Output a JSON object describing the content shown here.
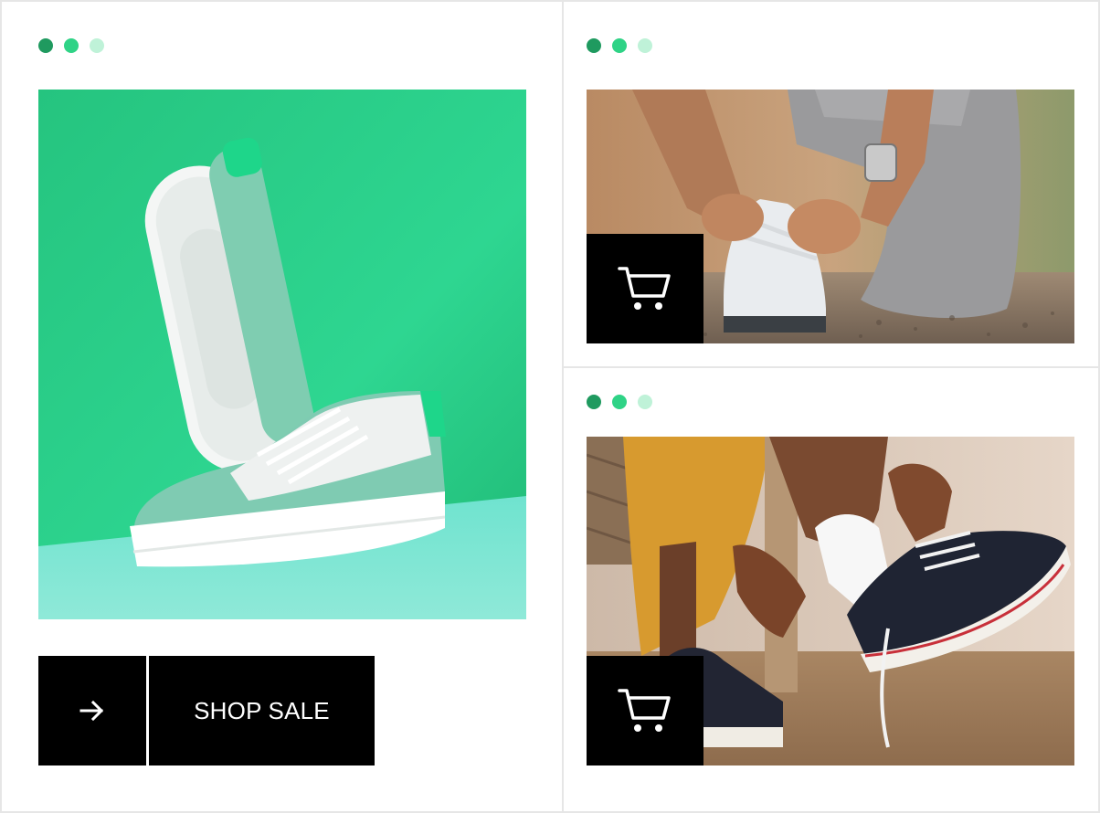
{
  "theme": {
    "dot_colors": [
      "#1f9a5f",
      "#2fd386",
      "#bff2d8"
    ],
    "button_bg": "#000000",
    "button_fg": "#ffffff",
    "frame_border": "#e6e6e6"
  },
  "main_card": {
    "image": "green-sneakers-product-photo",
    "cta": {
      "arrow_icon": "arrow-right-icon",
      "label": "SHOP SALE"
    }
  },
  "top_right_card": {
    "image": "person-tying-running-shoe-photo",
    "cart_icon": "shopping-cart-icon"
  },
  "bottom_right_card": {
    "image": "person-tying-canvas-sneaker-photo",
    "cart_icon": "shopping-cart-icon"
  }
}
